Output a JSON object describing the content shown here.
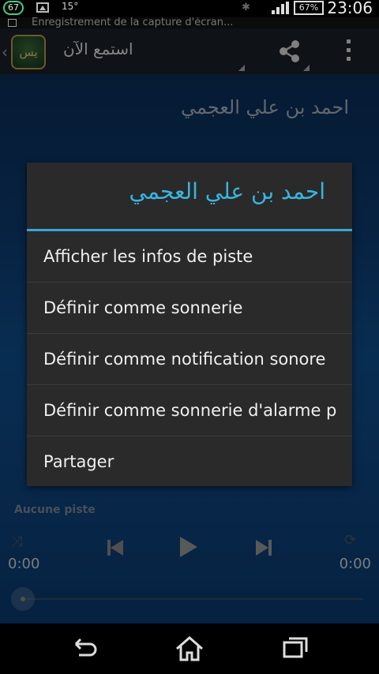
{
  "status_bar": {
    "badge": "67",
    "temperature": "15°",
    "battery": "67%",
    "time": "23:06",
    "icons": [
      "notification-count-icon",
      "image-icon",
      "bluetooth-icon",
      "signal-icon",
      "battery-icon"
    ]
  },
  "ticker": {
    "text": "Enregistrement de la capture d'écran..."
  },
  "action_bar": {
    "title": "استمع الآن",
    "logo_text": "يس",
    "icons": [
      "back-chevron-icon",
      "app-logo",
      "share-icon",
      "overflow-menu-icon"
    ]
  },
  "background": {
    "reciter_name": "احمد بن علي العجمي"
  },
  "dialog": {
    "title": "احمد بن علي العجمي",
    "accent_color": "#33a8d8",
    "items": [
      "Afficher les infos de piste",
      "Définir comme sonnerie",
      "Définir comme notification sonore",
      "Définir comme sonnerie d'alarme p",
      "Partager"
    ]
  },
  "player": {
    "track": "Aucune piste",
    "elapsed": "0:00",
    "duration": "0:00",
    "icons": [
      "shuffle-icon",
      "previous-icon",
      "play-icon",
      "next-icon",
      "repeat-icon"
    ]
  },
  "nav_bar": {
    "icons": [
      "back-icon",
      "home-icon",
      "recent-apps-icon"
    ]
  }
}
